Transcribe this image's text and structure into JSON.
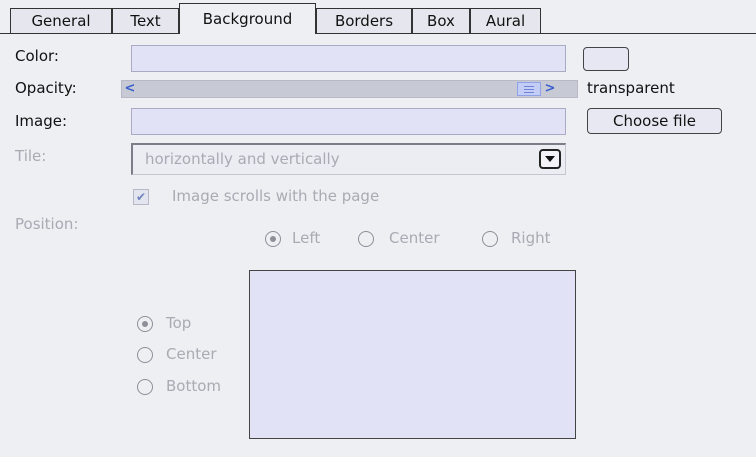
{
  "tabs": [
    {
      "label": "General",
      "active": false
    },
    {
      "label": "Text",
      "active": false
    },
    {
      "label": "Background",
      "active": true
    },
    {
      "label": "Borders",
      "active": false
    },
    {
      "label": "Box",
      "active": false
    },
    {
      "label": "Aural",
      "active": false
    }
  ],
  "color": {
    "label": "Color:",
    "value": ""
  },
  "opacity": {
    "label": "Opacity:",
    "value_text": "transparent",
    "slider_level": 1.0,
    "left_arrow": "<",
    "right_arrow": ">"
  },
  "image": {
    "label": "Image:",
    "value": "",
    "choose_button": "Choose file"
  },
  "tile": {
    "label": "Tile:",
    "selected": "horizontally and vertically"
  },
  "scroll": {
    "label": "Image scrolls with the page",
    "checked": true
  },
  "position": {
    "label": "Position:",
    "horizontal": [
      {
        "label": "Left",
        "checked": true
      },
      {
        "label": "Center",
        "checked": false
      },
      {
        "label": "Right",
        "checked": false
      }
    ],
    "vertical": [
      {
        "label": "Top",
        "checked": true
      },
      {
        "label": "Center",
        "checked": false
      },
      {
        "label": "Bottom",
        "checked": false
      }
    ]
  },
  "colors": {
    "background": "#eeeff3",
    "field": "#e2e2f6",
    "accent": "#3a5fcd",
    "disabled_text": "#a9aab3"
  }
}
